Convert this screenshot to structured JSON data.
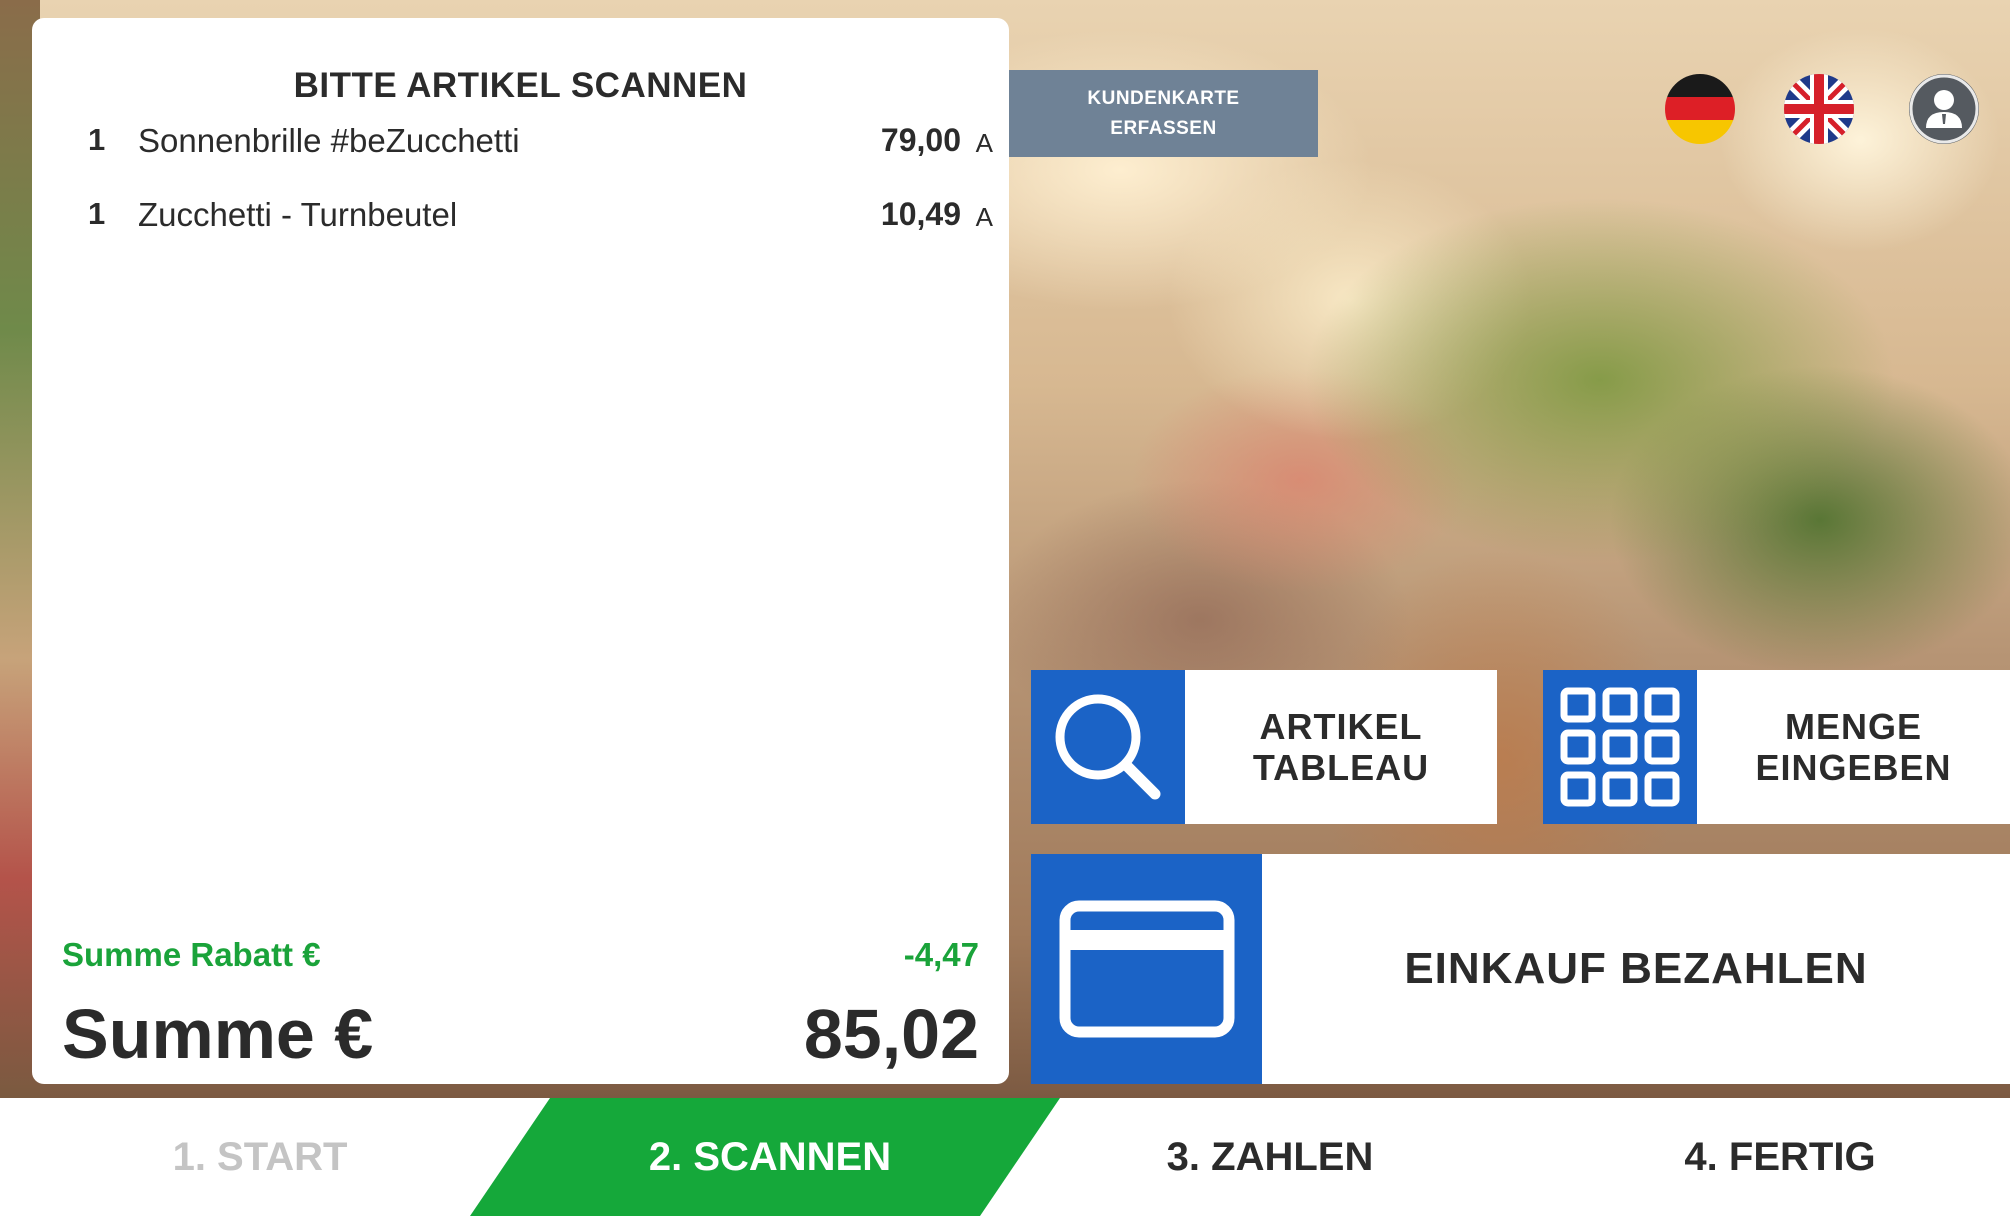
{
  "receipt": {
    "title": "BITTE ARTIKEL SCANNEN",
    "items": [
      {
        "qty": "1",
        "name": "Sonnenbrille #beZucchetti",
        "price": "79,00",
        "tax": "A"
      },
      {
        "qty": "1",
        "name": "Zucchetti - Turnbeutel",
        "price": "10,49",
        "tax": "A"
      }
    ],
    "discount_label": "Summe Rabatt €",
    "discount_value": "-4,47",
    "total_label": "Summe €",
    "total_value": "85,02"
  },
  "header": {
    "customer_card_line1": "KUNDENKARTE",
    "customer_card_line2": "ERFASSEN",
    "language_de_icon": "german-flag-icon",
    "language_en_icon": "uk-flag-icon",
    "user_icon": "user-icon"
  },
  "actions": {
    "artikel_line1": "ARTIKEL",
    "artikel_line2": "TABLEAU",
    "artikel_icon": "search-icon",
    "menge_line1": "MENGE",
    "menge_line2": "EINGEBEN",
    "menge_icon": "keypad-grid-icon",
    "pay_label": "EINKAUF BEZAHLEN",
    "pay_icon": "credit-card-icon"
  },
  "steps": [
    {
      "label": "1. START",
      "state": "done"
    },
    {
      "label": "2. SCANNEN",
      "state": "active"
    },
    {
      "label": "3. ZAHLEN",
      "state": "pending"
    },
    {
      "label": "4. FERTIG",
      "state": "pending"
    }
  ],
  "colors": {
    "accent_blue": "#1b63c6",
    "accent_green": "#15a83a",
    "customer_card_bg": "#6f8296",
    "discount_green": "#1aa33a"
  }
}
